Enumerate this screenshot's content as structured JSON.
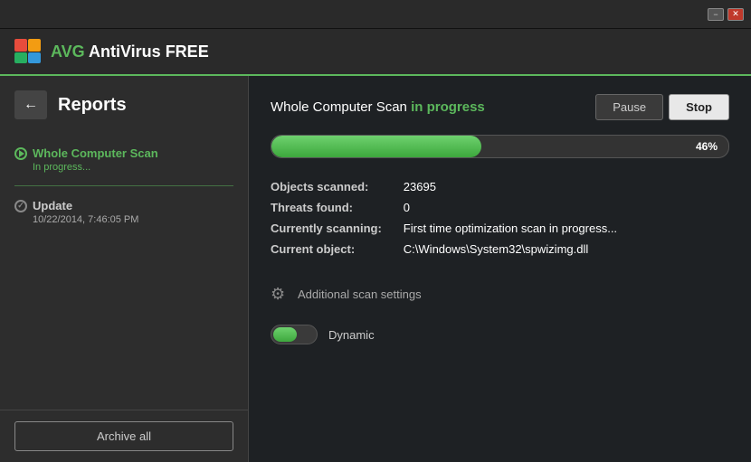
{
  "titlebar": {
    "minimize_label": "−",
    "close_label": "✕"
  },
  "header": {
    "logo_abbr": "AVG",
    "app_name": " AntiVirus FREE"
  },
  "sidebar": {
    "title": "Reports",
    "back_label": "←",
    "items": [
      {
        "id": "whole-computer-scan",
        "title": "Whole Computer Scan",
        "subtitle": "In progress...",
        "active": true,
        "icon": "play"
      },
      {
        "id": "update",
        "title": "Update",
        "subtitle": "10/22/2014, 7:46:05 PM",
        "active": false,
        "icon": "check"
      }
    ],
    "archive_all_label": "Archive all"
  },
  "content": {
    "scan_title_prefix": "Whole Computer Scan ",
    "scan_title_status": "in progress",
    "pause_label": "Pause",
    "stop_label": "Stop",
    "progress_percent": 46,
    "progress_label": "46%",
    "stats": [
      {
        "label": "Objects scanned:",
        "value": "23695"
      },
      {
        "label": "Threats found:",
        "value": "0"
      },
      {
        "label": "Currently scanning:",
        "value": "First time optimization scan in progress..."
      },
      {
        "label": "Current object:",
        "value": "C:\\Windows\\System32\\spwizimg.dll"
      }
    ],
    "additional_settings_label": "Additional scan settings",
    "toggle_label": "Dynamic"
  }
}
